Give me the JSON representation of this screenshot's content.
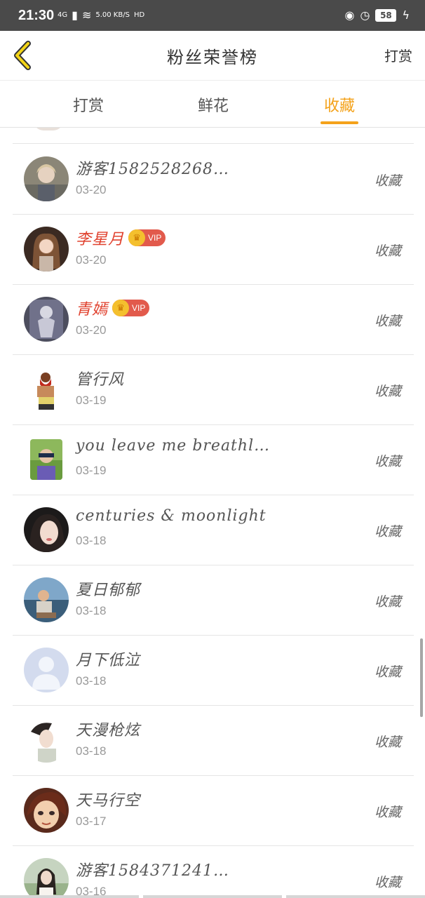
{
  "status_bar": {
    "time": "21:30",
    "network": "4G",
    "speed": "5.00 KB/S",
    "hd": "HD",
    "battery": "58"
  },
  "header": {
    "title": "粉丝荣誉榜",
    "action": "打赏"
  },
  "tabs": [
    {
      "label": "打赏",
      "active": false
    },
    {
      "label": "鲜花",
      "active": false
    },
    {
      "label": "收藏",
      "active": true
    }
  ],
  "vip_label": "VIP",
  "rows": [
    {
      "name": "游客1582528268…",
      "date": "03-20",
      "action": "收藏",
      "vip": false
    },
    {
      "name": "李星月",
      "date": "03-20",
      "action": "收藏",
      "vip": true
    },
    {
      "name": "青嫣",
      "date": "03-20",
      "action": "收藏",
      "vip": true
    },
    {
      "name": "管行风",
      "date": "03-19",
      "action": "收藏",
      "vip": false
    },
    {
      "name": "you leave me breathl…",
      "date": "03-19",
      "action": "收藏",
      "vip": false
    },
    {
      "name": "centuries & moonlight",
      "date": "03-18",
      "action": "收藏",
      "vip": false
    },
    {
      "name": "夏日郁郁",
      "date": "03-18",
      "action": "收藏",
      "vip": false
    },
    {
      "name": "月下低泣",
      "date": "03-18",
      "action": "收藏",
      "vip": false
    },
    {
      "name": "天漫枪炫",
      "date": "03-18",
      "action": "收藏",
      "vip": false
    },
    {
      "name": "天马行空",
      "date": "03-17",
      "action": "收藏",
      "vip": false
    },
    {
      "name": "游客1584371241…",
      "date": "03-16",
      "action": "收藏",
      "vip": false
    }
  ],
  "colors": {
    "accent": "#f4a21a",
    "vip_name": "#e0412e",
    "vip_badge": "#e25a4c",
    "status_bar": "#4a4a4a"
  }
}
